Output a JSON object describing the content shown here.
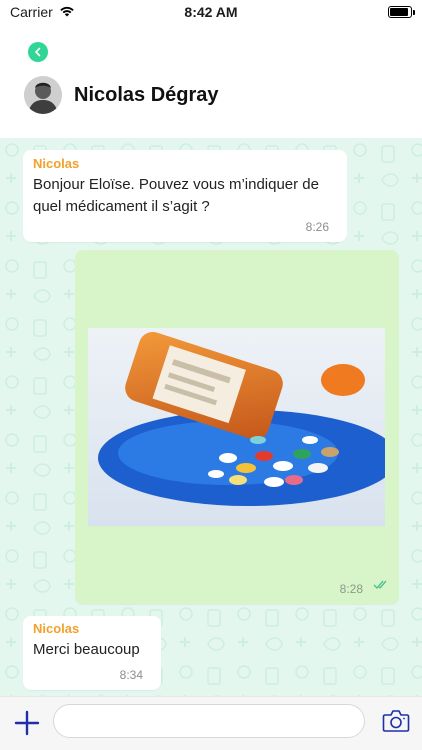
{
  "status_bar": {
    "carrier": "Carrier",
    "time": "8:42 AM",
    "battery_level": 0.9
  },
  "header": {
    "contact_name": "Nicolas Dégray",
    "back_color": "#2fd695"
  },
  "messages": [
    {
      "sender": "Nicolas",
      "text": "Bonjour Eloïse. Pouvez vous m’indiquer de quel médicament il s’agit ?",
      "time": "8:26"
    },
    {
      "type": "image",
      "image_subject": "pill bottle with spilled pills",
      "time": "8:28",
      "status": "read"
    },
    {
      "sender": "Nicolas",
      "text": "Merci beaucoup",
      "time": "8:34"
    }
  ],
  "input": {
    "placeholder": ""
  },
  "colors": {
    "accent": "#1e2fa8",
    "sender_name": "#f1a12c",
    "outgoing_bubble": "#d7f5c9",
    "chat_background": "#e4f7ef"
  }
}
